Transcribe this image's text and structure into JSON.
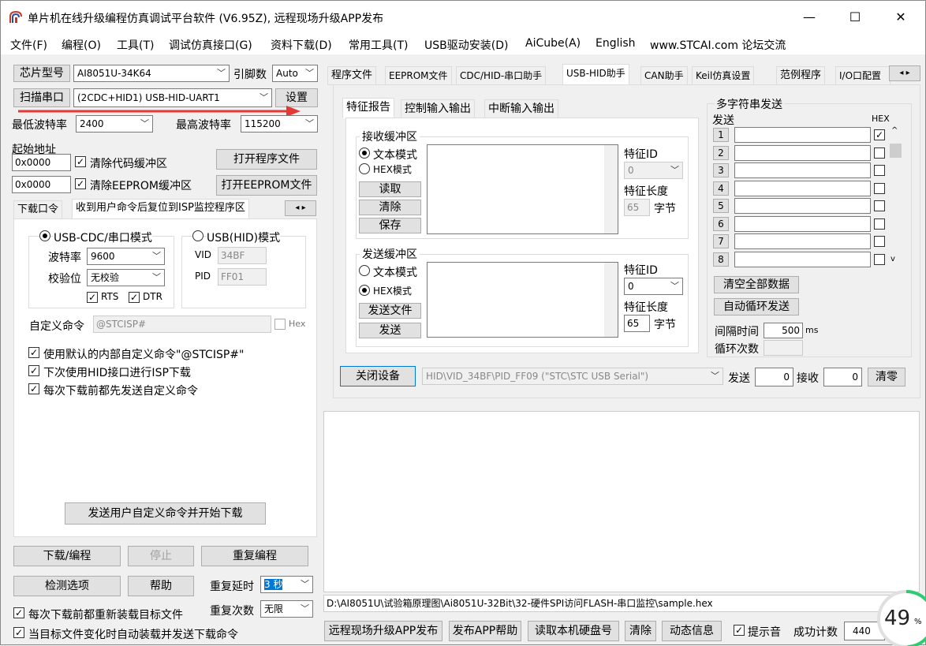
{
  "window": {
    "title": "单片机在线升级编程仿真调试平台软件 (V6.95Z), 远程现场升级APP发布",
    "min": "—",
    "max": "☐",
    "close": "✕"
  },
  "menu": [
    "文件(F)",
    "编程(O)",
    "工具(T)",
    "调试仿真接口(G)",
    "资料下载(D)",
    "常用工具(T)",
    "USB驱动安装(D)",
    "AiCube(A)",
    "English",
    "www.STCAI.com 论坛交流"
  ],
  "left": {
    "chip_label": "芯片型号",
    "chip_value": "AI8051U-34K64",
    "pin_label": "引脚数",
    "pin_value": "Auto",
    "scan_label": "扫描串口",
    "port_value": "(2CDC+HID1) USB-HID-UART1",
    "settings_label": "设置",
    "min_baud_label": "最低波特率",
    "min_baud_value": "2400",
    "max_baud_label": "最高波特率",
    "max_baud_value": "115200",
    "start_addr_label": "起始地址",
    "addr1": "0x0000",
    "clear_code": "清除代码缓冲区",
    "open_prog": "打开程序文件",
    "addr2": "0x0000",
    "clear_eeprom": "清除EEPROM缓冲区",
    "open_eeprom": "打开EEPROM文件",
    "tabs": [
      "下载口令",
      "收到用户命令后复位到ISP监控程序区"
    ],
    "mode_cdc": "USB-CDC/串口模式",
    "mode_hid": "USB(HID)模式",
    "baud_label": "波特率",
    "baud_value": "9600",
    "parity_label": "校验位",
    "parity_value": "无校验",
    "rts": "RTS",
    "dtr": "DTR",
    "vid_label": "VID",
    "vid_value": "34BF",
    "pid_label": "PID",
    "pid_value": "FF01",
    "custom_cmd_label": "自定义命令",
    "custom_cmd_value": "@STCISP#",
    "hex_label": "Hex",
    "opt1": "使用默认的内部自定义命令\"@STCISP#\"",
    "opt2": "下次使用HID接口进行ISP下载",
    "opt3": "每次下载前都先发送自定义命令",
    "send_cmd_btn": "发送用户自定义命令并开始下载",
    "download_btn": "下载/编程",
    "stop_btn": "停止",
    "reprogram_btn": "重复编程",
    "check_btn": "检测选项",
    "help_btn": "帮助",
    "repeat_delay_label": "重复延时",
    "repeat_delay_value": "3 秒",
    "reload_label": "每次下载前都重新装载目标文件",
    "repeat_count_label": "重复次数",
    "repeat_count_value": "无限",
    "autoload_label": "当目标文件变化时自动装载并发送下载命令"
  },
  "right": {
    "tabs": [
      "程序文件",
      "EEPROM文件",
      "CDC/HID-串口助手",
      "USB-HID助手",
      "CAN助手",
      "Keil仿真设置",
      "范例程序",
      "I/O口配置"
    ],
    "subtabs": [
      "特征报告",
      "控制输入输出",
      "中断输入输出"
    ],
    "recv_group": "接收缓冲区",
    "text_mode": "文本模式",
    "hex_mode": "HEX模式",
    "read_btn": "读取",
    "clear_btn": "清除",
    "save_btn": "保存",
    "feature_id_label": "特征ID",
    "recv_id": "0",
    "feature_len_label": "特征长度",
    "recv_len": "65",
    "bytes": "字节",
    "send_group": "发送缓冲区",
    "send_file_btn": "发送文件",
    "send_btn": "发送",
    "send_id": "0",
    "send_len": "65",
    "multi_title": "多字符串发送",
    "send_col": "发送",
    "hex_col": "HEX",
    "rows": [
      "1",
      "2",
      "3",
      "4",
      "5",
      "6",
      "7",
      "8"
    ],
    "clear_all_btn": "清空全部数据",
    "auto_loop_btn": "自动循环发送",
    "interval_label": "间隔时间",
    "interval_value": "500",
    "ms": "ms",
    "loop_label": "循环次数",
    "close_dev_btn": "关闭设备",
    "device_value": "HID\\VID_34BF\\PID_FF09 (\"STC\\STC USB Serial\")",
    "send_count_label": "发送",
    "send_count": "0",
    "recv_count_label": "接收",
    "recv_count": "0",
    "clear_zero_btn": "清零",
    "file_path": "D:\\AI8051U\\试验箱原理图\\Ai8051U-32Bit\\32-硬件SPI访问FLASH-串口监控\\sample.hex",
    "bottom_btns": [
      "远程现场升级APP发布",
      "发布APP帮助",
      "读取本机硬盘号",
      "清除",
      "动态信息"
    ],
    "beep_label": "提示音",
    "success_label": "成功计数",
    "success_value": "440"
  },
  "overlay": {
    "percent": "49",
    "unit": "%"
  }
}
